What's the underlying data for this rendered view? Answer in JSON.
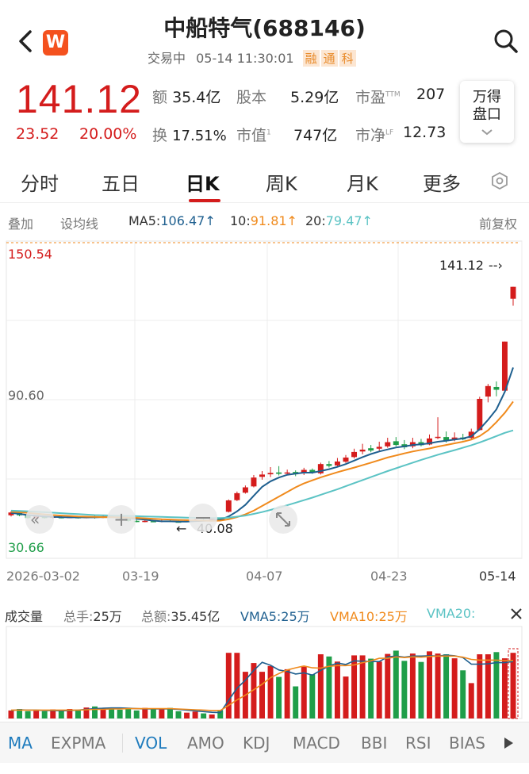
{
  "header": {
    "title": "中船特气(688146)",
    "status": "交易中",
    "datetime": "05-14 11:30:01",
    "tags": [
      "融",
      "通",
      "科"
    ],
    "logo_letter": "W"
  },
  "quote": {
    "price": "141.12",
    "change": "23.52",
    "change_pct": "20.00%",
    "stats": {
      "amount_label": "额",
      "amount": "35.4亿",
      "shares_label": "股本",
      "shares": "5.29亿",
      "pe_label": "市盈",
      "pe_sup": "TTM",
      "pe": "207",
      "turnover_label": "换",
      "turnover": "17.51%",
      "mktcap_label": "市值",
      "mktcap_sup": "1",
      "mktcap": "747亿",
      "pb_label": "市净",
      "pb_sup": "LF",
      "pb": "12.73"
    },
    "wande_line1": "万得",
    "wande_line2": "盘口"
  },
  "tabs": [
    "分时",
    "五日",
    "日K",
    "周K",
    "月K",
    "更多"
  ],
  "active_tab": "日K",
  "ma_row": {
    "overlay": "叠加",
    "avg_line": "设均线",
    "ma5_label": "MA5:",
    "ma5": "106.47↑",
    "ma10_label": "10:",
    "ma10": "91.81↑",
    "ma20_label": "20:",
    "ma20": "79.47↑",
    "adjust": "前复权"
  },
  "chart_labels": {
    "y_top": "150.54",
    "y_mid": "90.60",
    "y_bottom": "30.66",
    "last_price_marker": "141.12",
    "low_marker": "40.08",
    "dates": [
      "2026-03-02",
      "03-19",
      "04-07",
      "04-23",
      "05-14"
    ]
  },
  "chart_data": {
    "type": "candlestick",
    "ylim": [
      30.66,
      150.54
    ],
    "candles": [
      {
        "o": 43.0,
        "c": 44.2,
        "h": 44.8,
        "l": 42.5
      },
      {
        "o": 44.2,
        "c": 43.0,
        "h": 44.6,
        "l": 42.6
      },
      {
        "o": 43.1,
        "c": 41.8,
        "h": 43.4,
        "l": 41.5
      },
      {
        "o": 41.8,
        "c": 42.5,
        "h": 43.0,
        "l": 41.4
      },
      {
        "o": 42.3,
        "c": 41.9,
        "h": 42.8,
        "l": 41.6
      },
      {
        "o": 41.9,
        "c": 42.4,
        "h": 42.9,
        "l": 41.5
      },
      {
        "o": 42.2,
        "c": 42.0,
        "h": 42.6,
        "l": 41.7
      },
      {
        "o": 42.0,
        "c": 42.3,
        "h": 42.7,
        "l": 41.8
      },
      {
        "o": 42.2,
        "c": 41.9,
        "h": 42.5,
        "l": 41.6
      },
      {
        "o": 41.9,
        "c": 42.3,
        "h": 42.6,
        "l": 41.7
      },
      {
        "o": 42.4,
        "c": 42.0,
        "h": 42.8,
        "l": 41.6
      },
      {
        "o": 42.0,
        "c": 42.6,
        "h": 43.0,
        "l": 41.8
      },
      {
        "o": 42.6,
        "c": 42.2,
        "h": 43.0,
        "l": 41.9
      },
      {
        "o": 42.2,
        "c": 41.7,
        "h": 42.6,
        "l": 41.4
      },
      {
        "o": 41.5,
        "c": 40.6,
        "h": 41.8,
        "l": 40.3
      },
      {
        "o": 40.6,
        "c": 40.2,
        "h": 41.0,
        "l": 40.0
      },
      {
        "o": 40.3,
        "c": 40.6,
        "h": 41.0,
        "l": 40.0
      },
      {
        "o": 40.5,
        "c": 40.2,
        "h": 40.9,
        "l": 40.1
      },
      {
        "o": 40.3,
        "c": 40.7,
        "h": 41.1,
        "l": 40.0
      },
      {
        "o": 40.7,
        "c": 40.4,
        "h": 41.0,
        "l": 40.1
      },
      {
        "o": 40.3,
        "c": 40.1,
        "h": 40.8,
        "l": 40.08
      },
      {
        "o": 40.2,
        "c": 40.6,
        "h": 41.0,
        "l": 40.1
      },
      {
        "o": 40.6,
        "c": 41.2,
        "h": 41.6,
        "l": 40.4
      },
      {
        "o": 41.1,
        "c": 40.7,
        "h": 41.4,
        "l": 40.5
      },
      {
        "o": 40.8,
        "c": 41.4,
        "h": 41.9,
        "l": 40.6
      },
      {
        "o": 41.5,
        "c": 41.0,
        "h": 41.8,
        "l": 40.7
      },
      {
        "o": 44.5,
        "c": 49.4,
        "h": 49.8,
        "l": 44.2
      },
      {
        "o": 49.5,
        "c": 52.5,
        "h": 53.2,
        "l": 49.1
      },
      {
        "o": 52.7,
        "c": 55.0,
        "h": 55.8,
        "l": 52.3
      },
      {
        "o": 55.4,
        "c": 59.2,
        "h": 60.3,
        "l": 55.0
      },
      {
        "o": 59.5,
        "c": 60.5,
        "h": 62.0,
        "l": 58.3
      },
      {
        "o": 60.6,
        "c": 61.2,
        "h": 63.7,
        "l": 59.4
      },
      {
        "o": 61.4,
        "c": 60.8,
        "h": 64.1,
        "l": 60.1
      },
      {
        "o": 60.9,
        "c": 61.4,
        "h": 62.6,
        "l": 60.3
      },
      {
        "o": 61.6,
        "c": 60.6,
        "h": 62.3,
        "l": 59.8
      },
      {
        "o": 61.0,
        "c": 62.5,
        "h": 63.4,
        "l": 60.3
      },
      {
        "o": 62.5,
        "c": 61.2,
        "h": 63.1,
        "l": 60.8
      },
      {
        "o": 61.0,
        "c": 65.0,
        "h": 65.6,
        "l": 60.5
      },
      {
        "o": 65.0,
        "c": 64.2,
        "h": 66.3,
        "l": 63.5
      },
      {
        "o": 64.4,
        "c": 66.1,
        "h": 67.6,
        "l": 63.8
      },
      {
        "o": 66.0,
        "c": 67.8,
        "h": 68.9,
        "l": 65.5
      },
      {
        "o": 68.0,
        "c": 70.2,
        "h": 71.6,
        "l": 67.4
      },
      {
        "o": 70.4,
        "c": 71.2,
        "h": 73.7,
        "l": 69.2
      },
      {
        "o": 71.8,
        "c": 70.8,
        "h": 73.2,
        "l": 70.1
      },
      {
        "o": 71.6,
        "c": 72.4,
        "h": 74.6,
        "l": 70.7
      },
      {
        "o": 72.6,
        "c": 74.4,
        "h": 76.3,
        "l": 72.0
      },
      {
        "o": 74.8,
        "c": 73.2,
        "h": 76.6,
        "l": 72.6
      },
      {
        "o": 73.5,
        "c": 72.2,
        "h": 75.3,
        "l": 71.4
      },
      {
        "o": 72.6,
        "c": 74.4,
        "h": 76.3,
        "l": 71.8
      },
      {
        "o": 74.4,
        "c": 73.1,
        "h": 75.8,
        "l": 72.6
      },
      {
        "o": 73.4,
        "c": 76.0,
        "h": 77.7,
        "l": 73.1
      },
      {
        "o": 76.2,
        "c": 76.7,
        "h": 85.1,
        "l": 75.7
      },
      {
        "o": 76.6,
        "c": 75.0,
        "h": 79.0,
        "l": 74.2
      },
      {
        "o": 75.4,
        "c": 76.4,
        "h": 78.6,
        "l": 74.8
      },
      {
        "o": 76.4,
        "c": 75.6,
        "h": 78.0,
        "l": 75.2
      },
      {
        "o": 76.2,
        "c": 78.9,
        "h": 80.2,
        "l": 75.5
      },
      {
        "o": 79.6,
        "c": 93.0,
        "h": 93.9,
        "l": 79.4
      },
      {
        "o": 94.0,
        "c": 98.5,
        "h": 99.4,
        "l": 91.5
      },
      {
        "o": 98.1,
        "c": 96.9,
        "h": 100.5,
        "l": 94.1
      },
      {
        "o": 96.5,
        "c": 117.6,
        "h": 117.6,
        "l": 96.1
      },
      {
        "o": 136.0,
        "c": 141.12,
        "h": 141.12,
        "l": 133.0
      }
    ],
    "ma5": [
      44,
      43.6,
      43.1,
      42.8,
      42.5,
      42.3,
      42.2,
      42.1,
      42.1,
      42.1,
      42.1,
      42.2,
      42.2,
      42.1,
      41.8,
      41.5,
      41.1,
      40.7,
      40.4,
      40.4,
      40.3,
      40.3,
      40.5,
      40.6,
      40.8,
      41.0,
      42.5,
      44.7,
      47.5,
      51.4,
      55.2,
      57.6,
      59.2,
      60.4,
      60.9,
      61.3,
      61.3,
      62.0,
      62.8,
      63.8,
      65.0,
      66.5,
      68.0,
      69.3,
      70.4,
      71.3,
      72.1,
      72.6,
      73.2,
      73.5,
      73.9,
      74.6,
      75.0,
      75.5,
      76.0,
      76.9,
      80.0,
      84.0,
      88.5,
      96.0,
      106.47
    ],
    "ma10": [
      44.5,
      44.3,
      44.0,
      43.7,
      43.4,
      43.1,
      42.9,
      42.7,
      42.5,
      42.4,
      42.3,
      42.2,
      42.2,
      42.1,
      42.0,
      41.9,
      41.7,
      41.5,
      41.3,
      41.2,
      41.0,
      40.9,
      40.8,
      40.7,
      40.6,
      40.7,
      41.3,
      42.2,
      43.4,
      45.0,
      47.0,
      49.0,
      51.0,
      53.0,
      55.0,
      56.7,
      58.0,
      59.3,
      60.4,
      61.5,
      62.5,
      63.5,
      64.5,
      65.6,
      66.7,
      67.8,
      68.7,
      69.6,
      70.4,
      71.1,
      71.7,
      72.5,
      73.2,
      73.9,
      74.6,
      75.5,
      77.0,
      79.5,
      83.0,
      87.0,
      91.81
    ],
    "ma20": [
      45.0,
      44.9,
      44.7,
      44.5,
      44.3,
      44.1,
      43.9,
      43.7,
      43.5,
      43.3,
      43.1,
      43.0,
      42.9,
      42.8,
      42.7,
      42.6,
      42.5,
      42.4,
      42.3,
      42.2,
      42.1,
      42.0,
      41.9,
      41.8,
      41.8,
      41.8,
      42.0,
      42.4,
      42.9,
      43.6,
      44.4,
      45.3,
      46.3,
      47.3,
      48.4,
      49.5,
      50.6,
      51.8,
      53.0,
      54.2,
      55.5,
      56.8,
      58.1,
      59.4,
      60.7,
      62.0,
      63.2,
      64.4,
      65.6,
      66.8,
      67.9,
      69.0,
      70.0,
      71.0,
      72.0,
      73.1,
      74.3,
      75.6,
      77.0,
      78.4,
      79.47
    ],
    "ma_values": {
      "ma5": 106.47,
      "ma10": 91.81,
      "ma20": 79.47
    }
  },
  "vol_row": {
    "title": "成交量",
    "total_hands_label": "总手:",
    "total_hands": "25万",
    "total_amount_label": "总额:",
    "total_amount": "35.45亿",
    "vma5": "VMA5:25万",
    "vma10": "VMA10:25万",
    "vma20": "VMA20:"
  },
  "volume_data": {
    "values": [
      2.2,
      2.6,
      2.0,
      2.1,
      2.0,
      2.5,
      2.0,
      2.6,
      2.3,
      3.0,
      3.3,
      2.8,
      2.9,
      2.4,
      2.9,
      2.2,
      2.9,
      2.6,
      2.6,
      2.9,
      2.0,
      1.6,
      1.9,
      1.4,
      1.1,
      2.2,
      18.0,
      18.0,
      12.8,
      15.2,
      12.8,
      14.4,
      11.4,
      13.5,
      8.8,
      14.2,
      12.1,
      17.6,
      17.0,
      15.6,
      11.5,
      17.3,
      17.3,
      16.4,
      15.6,
      17.7,
      18.6,
      15.8,
      17.8,
      15.5,
      18.4,
      17.8,
      17.6,
      16.5,
      13.2,
      9.7,
      17.6,
      17.6,
      18.2,
      16.5,
      18.0
    ],
    "vma5": [
      2.2,
      2.4,
      2.3,
      2.3,
      2.2,
      2.2,
      2.1,
      2.2,
      2.3,
      2.5,
      2.7,
      2.8,
      2.9,
      2.9,
      2.8,
      2.7,
      2.6,
      2.6,
      2.6,
      2.6,
      2.5,
      2.3,
      2.1,
      1.9,
      1.7,
      1.6,
      5.0,
      8.3,
      10.5,
      13.2,
      15.4,
      14.6,
      13.3,
      12.9,
      12.2,
      12.5,
      11.9,
      13.2,
      14.4,
      15.2,
      14.8,
      15.8,
      15.7,
      15.6,
      15.6,
      16.9,
      17.1,
      16.8,
      17.1,
      17.1,
      17.2,
      17.1,
      17.4,
      17.2,
      16.7,
      14.9,
      14.9,
      15.0,
      15.3,
      15.3,
      15.6
    ],
    "vma10": [
      2.3,
      2.3,
      2.3,
      2.3,
      2.3,
      2.3,
      2.3,
      2.3,
      2.3,
      2.4,
      2.5,
      2.5,
      2.6,
      2.6,
      2.7,
      2.7,
      2.7,
      2.7,
      2.7,
      2.7,
      2.6,
      2.5,
      2.4,
      2.3,
      2.2,
      2.2,
      3.6,
      5.1,
      6.4,
      7.9,
      9.4,
      11.2,
      12.3,
      13.3,
      13.9,
      14.4,
      13.9,
      13.8,
      14.3,
      14.5,
      14.5,
      14.7,
      15.3,
      15.8,
      16.5,
      16.5,
      16.9,
      16.7,
      16.9,
      16.8,
      17.0,
      17.1,
      17.1,
      17.1,
      16.8,
      16.2,
      16.0,
      16.0,
      16.0,
      15.9,
      15.9
    ]
  },
  "indicators": [
    "MA",
    "EXPMA",
    "VOL",
    "AMO",
    "KDJ",
    "MACD",
    "BBI",
    "RSI",
    "BIAS"
  ],
  "indicator_active": [
    "MA",
    "VOL"
  ],
  "colors": {
    "up": "#d41c1c",
    "down": "#1f9e49",
    "ma5": "#1e5f8f",
    "ma10": "#f08a1c",
    "ma20": "#5bc3c4",
    "accent_blue": "#1e7bbd"
  }
}
